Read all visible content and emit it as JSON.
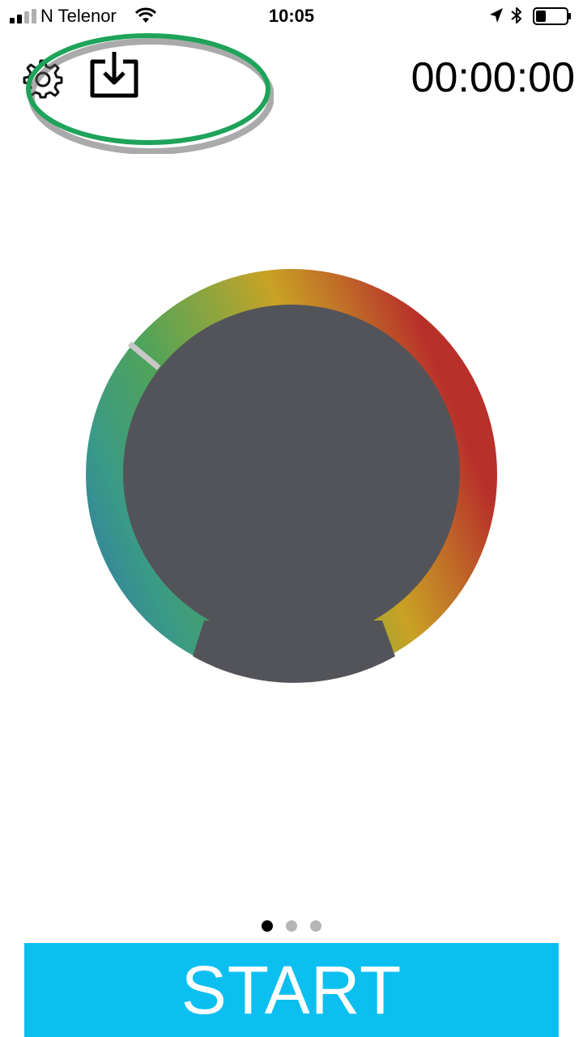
{
  "status_bar": {
    "carrier": "N Telenor",
    "time": "10:05",
    "icons": [
      "signal-icon",
      "wifi-icon",
      "location-arrow-icon",
      "bluetooth-icon",
      "battery-icon"
    ]
  },
  "header": {
    "timer": "00:00:00",
    "settings_icon": "gear-icon",
    "download_icon": "download-icon",
    "highlight_color": "#1ea35a"
  },
  "dial": {
    "gradient_colors": [
      "#2f6fb3",
      "#3a9a86",
      "#4fa35a",
      "#8fa53e",
      "#c9a224",
      "#c06d28",
      "#b8302a"
    ],
    "center_color": "#535459",
    "marker_color": "#c8c8c8"
  },
  "pager": {
    "page_count": 3,
    "current_page": 1
  },
  "start_button": {
    "label": "START",
    "color": "#0bbff0"
  }
}
